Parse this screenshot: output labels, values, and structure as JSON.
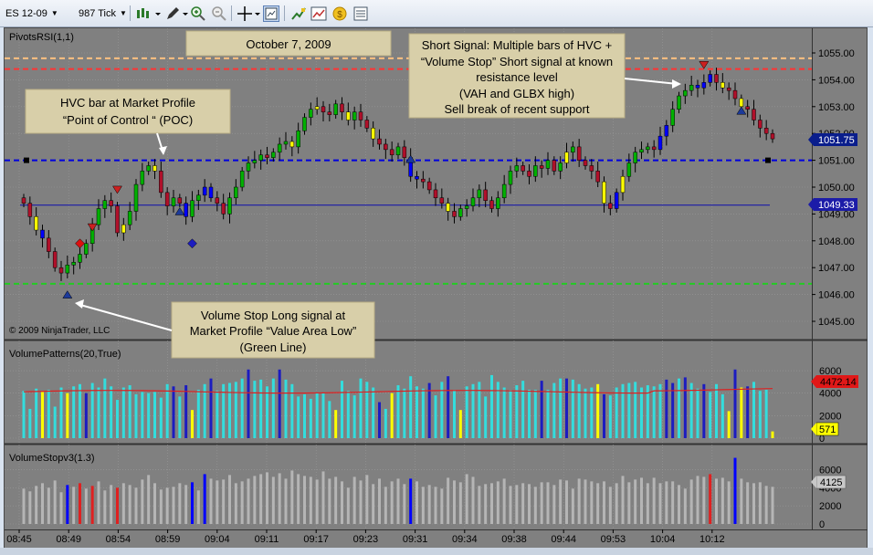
{
  "toolbar": {
    "instrument": "ES 12-09",
    "interval": "987 Tick",
    "icons": [
      "bar-chart-icon",
      "pencil-icon",
      "zoom-in-icon",
      "zoom-out-icon",
      "crosshair-icon",
      "chart-properties-icon",
      "strategies-icon",
      "indicators-icon",
      "money-icon",
      "data-box-icon"
    ]
  },
  "price_panel": {
    "indicator_label": "PivotsRSI(1,1)",
    "copyright": "© 2009 NinjaTrader, LLC",
    "price_labels": [
      "1055.00",
      "1054.00",
      "1053.00",
      "1052.00",
      "1051.00",
      "1050.00",
      "1049.00",
      "1048.00",
      "1047.00",
      "1046.00",
      "1045.00"
    ],
    "last_price": "1051.75",
    "value_area_price": "1049.33"
  },
  "volume_panel": {
    "indicator_label": "VolumePatterns(20,True)",
    "axis_labels": [
      "6000",
      "4000",
      "2000",
      "0"
    ],
    "avg_value": "4472.14",
    "last_value": "571"
  },
  "volstop_panel": {
    "indicator_label": "VolumeStopv3(1.3)",
    "axis_labels": [
      "6000",
      "4000",
      "2000",
      "0"
    ],
    "last_value": "4125"
  },
  "time_axis": [
    "08:45",
    "08:49",
    "08:54",
    "08:59",
    "09:04",
    "09:11",
    "09:17",
    "09:23",
    "09:31",
    "09:34",
    "09:38",
    "09:44",
    "09:53",
    "10:04",
    "10:12"
  ],
  "annotations": {
    "date": "October 7, 2009",
    "hvc_line1": "HVC bar at Market Profile",
    "hvc_line2": "“Point of Control “ (POC)",
    "short_line1": "Short Signal: Multiple bars of  HVC +",
    "short_line2": "“Volume Stop” Short signal at known",
    "short_line3": "resistance level",
    "short_line4": "(VAH and GLBX high)",
    "short_line5": "Sell break of recent support",
    "long_line1": "Volume Stop Long signal at",
    "long_line2": "Market Profile “Value Area Low”",
    "long_line3": "(Green Line)"
  },
  "colors": {
    "background": "#808080",
    "up_bar": "#00b000",
    "down_bar": "#b0102a",
    "hvc_bar": "#ffff00",
    "volume_stop_bar": "#0000ff",
    "volume_bar": "#33dddd",
    "volume_high": "#1c1cc0",
    "volume_low": "#ffff00",
    "volstop_bar": "#b5b5b5",
    "volstop_red": "#e02020",
    "poc_line": "#0000dd",
    "value_area_low": "#22cc22",
    "value_area_high": "#ff3333",
    "glbx_high": "#ffc080",
    "annotation_bg": "#d8cfa9"
  },
  "chart_data": {
    "type": "candlestick",
    "price_range": [
      1044.5,
      1055.5
    ],
    "open": [
      1049.6,
      1049.4,
      1048.9,
      1048.4,
      1048.1,
      1047.6,
      1047.0,
      1046.8,
      1047.1,
      1047.2,
      1047.5,
      1047.9,
      1048.6,
      1049.2,
      1049.5,
      1049.3,
      1048.3,
      1048.6,
      1049.1,
      1050.1,
      1050.6,
      1050.8,
      1050.6,
      1049.8,
      1049.3,
      1049.6,
      1049.4,
      1048.9,
      1049.5,
      1049.7,
      1050.0,
      1049.6,
      1049.4,
      1049.0,
      1049.6,
      1050.0,
      1050.6,
      1050.9,
      1051.0,
      1051.2,
      1051.1,
      1051.3,
      1051.6,
      1051.7,
      1051.5,
      1052.1,
      1052.6,
      1052.9,
      1053.0,
      1052.8,
      1052.7,
      1053.1,
      1052.8,
      1052.5,
      1052.8,
      1052.5,
      1052.2,
      1051.8,
      1051.6,
      1051.4,
      1051.2,
      1051.5,
      1051.1,
      1050.4,
      1050.3,
      1050.2,
      1049.9,
      1049.6,
      1049.4,
      1049.1,
      1048.9,
      1049.2,
      1049.3,
      1049.6,
      1049.9,
      1049.5,
      1049.2,
      1049.6,
      1050.1,
      1050.6,
      1050.8,
      1050.6,
      1050.4,
      1050.8,
      1050.7,
      1051.0,
      1050.6,
      1050.9,
      1051.3,
      1051.5,
      1051.0,
      1050.8,
      1050.6,
      1050.2,
      1049.4,
      1049.2,
      1049.8,
      1050.4,
      1050.9,
      1051.3,
      1051.4,
      1051.5,
      1051.4,
      1051.9,
      1052.3,
      1052.9,
      1053.4,
      1053.6,
      1053.8,
      1053.7,
      1053.9,
      1054.2,
      1053.9,
      1053.7,
      1053.6,
      1053.3,
      1053.0,
      1052.9,
      1052.5,
      1052.2,
      1052.0
    ],
    "close": [
      1049.4,
      1048.9,
      1048.4,
      1048.1,
      1047.6,
      1047.0,
      1046.8,
      1047.1,
      1047.2,
      1047.5,
      1047.9,
      1048.6,
      1049.2,
      1049.5,
      1049.3,
      1048.3,
      1048.6,
      1049.1,
      1050.1,
      1050.6,
      1050.8,
      1050.6,
      1049.8,
      1049.3,
      1049.6,
      1049.4,
      1048.9,
      1049.5,
      1049.7,
      1050.0,
      1049.6,
      1049.4,
      1049.0,
      1049.6,
      1050.0,
      1050.6,
      1050.9,
      1051.0,
      1051.2,
      1051.1,
      1051.3,
      1051.6,
      1051.7,
      1051.5,
      1052.1,
      1052.6,
      1052.9,
      1053.0,
      1052.8,
      1052.7,
      1053.1,
      1052.8,
      1052.5,
      1052.8,
      1052.5,
      1052.2,
      1051.8,
      1051.6,
      1051.4,
      1051.2,
      1051.5,
      1051.1,
      1050.4,
      1050.3,
      1050.2,
      1049.9,
      1049.6,
      1049.4,
      1049.1,
      1048.9,
      1049.2,
      1049.3,
      1049.6,
      1049.9,
      1049.5,
      1049.2,
      1049.6,
      1050.1,
      1050.6,
      1050.8,
      1050.6,
      1050.4,
      1050.8,
      1050.7,
      1051.0,
      1050.6,
      1050.9,
      1051.3,
      1051.5,
      1051.0,
      1050.8,
      1050.6,
      1050.2,
      1049.4,
      1049.2,
      1049.8,
      1050.4,
      1050.9,
      1051.3,
      1051.4,
      1051.5,
      1051.4,
      1051.9,
      1052.3,
      1052.9,
      1053.4,
      1053.6,
      1053.8,
      1053.7,
      1053.9,
      1054.2,
      1053.9,
      1053.7,
      1053.6,
      1053.3,
      1053.0,
      1052.9,
      1052.5,
      1052.2,
      1052.0,
      1051.8
    ],
    "volume": [
      4200,
      2600,
      4400,
      4100,
      4300,
      2800,
      4500,
      4000,
      4600,
      4800,
      4000,
      4900,
      4500,
      5300,
      4600,
      3400,
      4500,
      4700,
      3900,
      4100,
      4000,
      4100,
      3600,
      4800,
      4600,
      3700,
      4700,
      2500,
      4300,
      4800,
      5300,
      4200,
      4800,
      4900,
      5000,
      5300,
      6100,
      5100,
      5200,
      4600,
      5300,
      6100,
      5200,
      4800,
      3700,
      3900,
      3500,
      4000,
      4000,
      3300,
      2500,
      5100,
      4200,
      3800,
      5300,
      5000,
      4500,
      3200,
      2600,
      4000,
      4700,
      4400,
      5500,
      4600,
      4400,
      4900,
      3800,
      5000,
      5500,
      4300,
      2500,
      4600,
      4800,
      5000,
      3700,
      5600,
      5000,
      4500,
      4300,
      4700,
      5100,
      4300,
      4300,
      5100,
      4300,
      4900,
      5300,
      5300,
      5200,
      4800,
      4400,
      4500,
      4800,
      3900,
      3800,
      4500,
      4800,
      4900,
      5000,
      4500,
      4700,
      4600,
      4800,
      5200,
      4900,
      5300,
      5400,
      4900,
      4400,
      4800,
      4100,
      4800,
      3900,
      2400,
      6100,
      4500,
      4600,
      5000,
      4200,
      4300,
      600
    ],
    "volstop": [
      3900,
      3600,
      4200,
      4500,
      4000,
      4800,
      3500,
      4300,
      4100,
      4500,
      3900,
      4200,
      4700,
      3700,
      4300,
      4000,
      4500,
      4300,
      4000,
      4900,
      5400,
      4500,
      3800,
      4000,
      4100,
      4500,
      4300,
      4600,
      3700,
      5500,
      5000,
      4800,
      4900,
      5400,
      4500,
      4700,
      5000,
      5300,
      5500,
      5700,
      5200,
      5600,
      5000,
      5900,
      5500,
      5300,
      5200,
      4900,
      5800,
      5000,
      5200,
      4700,
      4000,
      5200,
      4800,
      5400,
      4400,
      5000,
      4100,
      4700,
      5000,
      4400,
      5000,
      4700,
      4100,
      4300,
      4100,
      3900,
      5100,
      4800,
      4600,
      5500,
      5200,
      4200,
      4400,
      4500,
      4700,
      5000,
      4200,
      4300,
      4500,
      4400,
      4100,
      4600,
      4600,
      4300,
      4900,
      4800,
      3900,
      5000,
      4900,
      4700,
      4500,
      4700,
      4100,
      4500,
      5300,
      4600,
      4900,
      5100,
      4500,
      5100,
      4500,
      4700,
      4700,
      4300,
      3900,
      4900,
      5300,
      5200,
      5500,
      5000,
      5100,
      4700,
      7300,
      5000,
      4600,
      4500,
      4600,
      4200,
      4100
    ],
    "poc": 1051.0,
    "value_area_low": 1046.4,
    "value_area_high": 1054.4,
    "glbx_high": 1054.8,
    "volume_avg": 4472.14,
    "volume_range": [
      0,
      7000
    ],
    "volstop_range": [
      0,
      7000
    ]
  }
}
